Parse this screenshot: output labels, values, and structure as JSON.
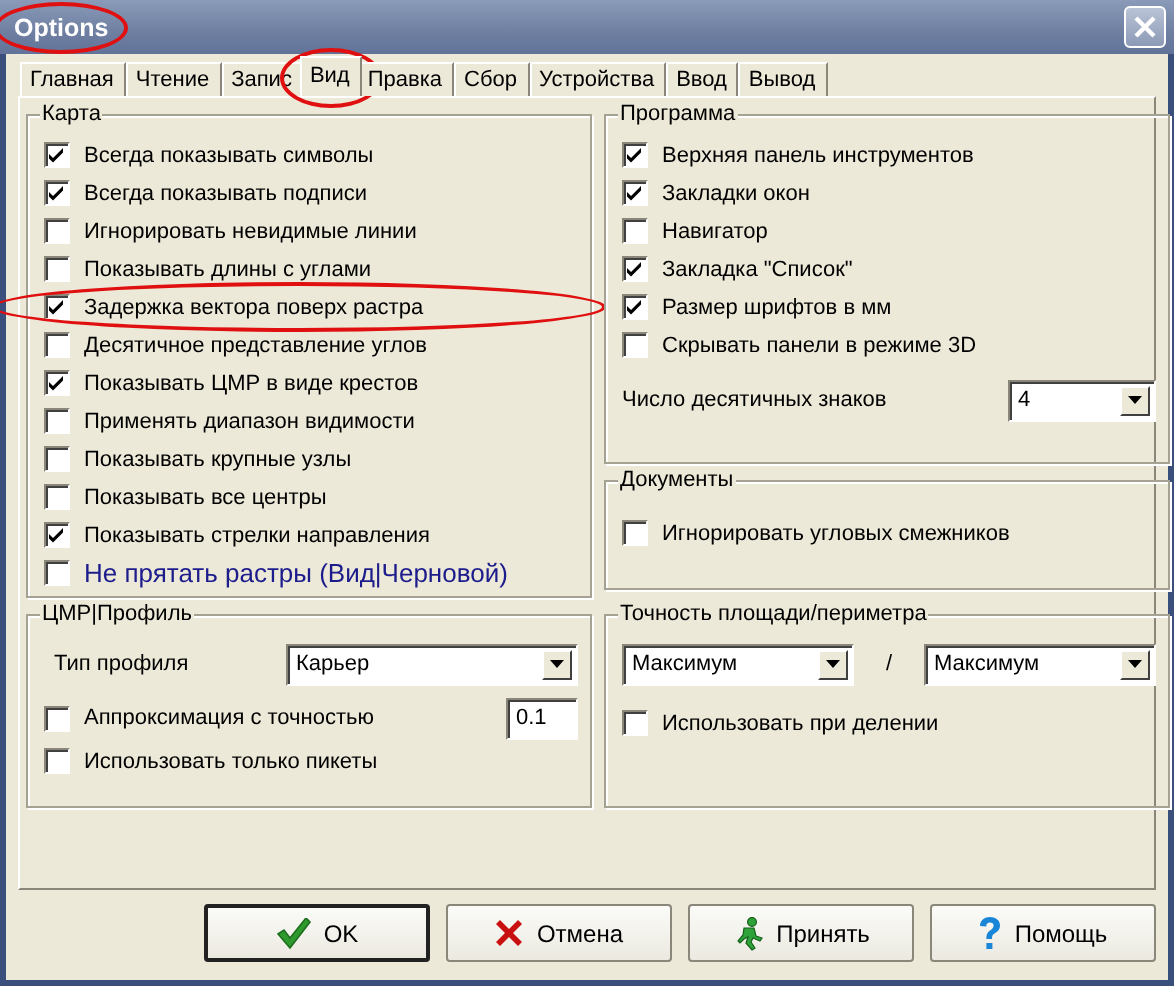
{
  "window": {
    "title": "Options",
    "title_circled": true
  },
  "tabs": [
    {
      "label": "Главная",
      "selected": false,
      "circled": false
    },
    {
      "label": "Чтение",
      "selected": false,
      "circled": false
    },
    {
      "label": "Запис",
      "selected": false,
      "circled": false
    },
    {
      "label": "Вид",
      "selected": true,
      "circled": true
    },
    {
      "label": "Правка",
      "selected": false,
      "circled": false
    },
    {
      "label": "Сбор",
      "selected": false,
      "circled": false
    },
    {
      "label": "Устройства",
      "selected": false,
      "circled": false
    },
    {
      "label": "Ввод",
      "selected": false,
      "circled": false
    },
    {
      "label": "Вывод",
      "selected": false,
      "circled": false
    }
  ],
  "map_group": {
    "title": "Карта",
    "items": [
      {
        "label": "Всегда показывать символы",
        "checked": true,
        "circled": false,
        "kind": "plain"
      },
      {
        "label": "Всегда показывать подписи",
        "checked": true,
        "circled": false,
        "kind": "plain"
      },
      {
        "label": "Игнорировать невидимые линии",
        "checked": false,
        "circled": false,
        "kind": "plain"
      },
      {
        "label": "Показывать длины с углами",
        "checked": false,
        "circled": false,
        "kind": "plain"
      },
      {
        "label": "Задержка вектора поверх растра",
        "checked": true,
        "circled": true,
        "kind": "plain"
      },
      {
        "label": "Десятичное представление углов",
        "checked": false,
        "circled": false,
        "kind": "plain"
      },
      {
        "label": "Показывать ЦМР в виде крестов",
        "checked": true,
        "circled": false,
        "kind": "plain"
      },
      {
        "label": "Применять диапазон видимости",
        "checked": false,
        "circled": false,
        "kind": "plain"
      },
      {
        "label": "Показывать крупные узлы",
        "checked": false,
        "circled": false,
        "kind": "plain"
      },
      {
        "label": "Показывать все центры",
        "checked": false,
        "circled": false,
        "kind": "plain"
      },
      {
        "label": "Показывать стрелки направления",
        "checked": true,
        "circled": false,
        "kind": "plain"
      },
      {
        "label": "Не прятать растры (Вид|Черновой)",
        "checked": false,
        "circled": false,
        "kind": "accent"
      }
    ]
  },
  "program_group": {
    "title": "Программа",
    "items": [
      {
        "label": "Верхняя панель инструментов",
        "checked": true
      },
      {
        "label": "Закладки окон",
        "checked": true
      },
      {
        "label": "Навигатор",
        "checked": false
      },
      {
        "label": "Закладка \"Список\"",
        "checked": true
      },
      {
        "label": "Размер шрифтов в мм",
        "checked": true
      },
      {
        "label": "Скрывать панели в режиме 3D",
        "checked": false
      }
    ],
    "decimals": {
      "label": "Число десятичных знаков",
      "value": "4"
    }
  },
  "documents_group": {
    "title": "Документы",
    "items": [
      {
        "label": "Игнорировать угловых смежников",
        "checked": false
      }
    ]
  },
  "profile_group": {
    "title": "ЦМР|Профиль",
    "profile_type": {
      "label": "Тип профиля",
      "value": "Карьер"
    },
    "approximation": {
      "label": "Аппроксимация с точностью",
      "checked": false,
      "value": "0.1"
    },
    "items": [
      {
        "label": "Использовать только пикеты",
        "checked": false
      }
    ]
  },
  "precision_group": {
    "title": "Точность площади/периметра",
    "area": {
      "value": "Максимум"
    },
    "separator": "/",
    "perimeter": {
      "value": "Максимум"
    },
    "items": [
      {
        "label": "Использовать при делении",
        "checked": false
      }
    ]
  },
  "buttons": [
    {
      "label": "OK",
      "kind": "ok",
      "default": true
    },
    {
      "label": "Отмена",
      "kind": "cancel",
      "default": false
    },
    {
      "label": "Принять",
      "kind": "apply",
      "default": false
    },
    {
      "label": "Помощь",
      "kind": "help",
      "default": false
    }
  ]
}
